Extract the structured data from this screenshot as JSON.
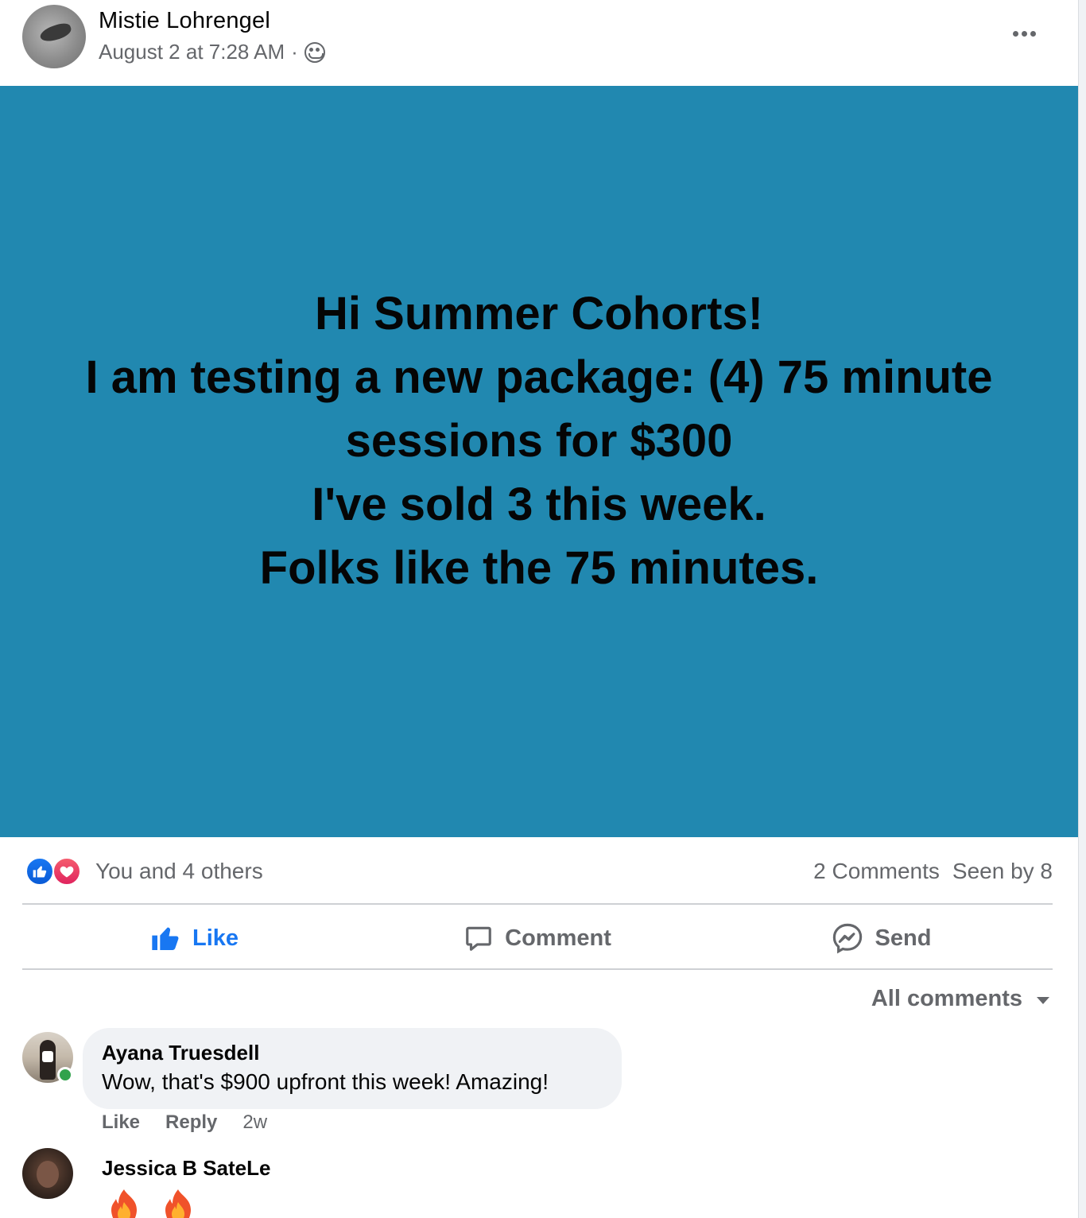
{
  "post": {
    "author": "Mistie Lohrengel",
    "timestamp": "August 2 at 7:28 AM",
    "separator": "·",
    "privacy_icon": "group-icon",
    "more_icon": "more-options-icon",
    "background_color": "#2188b0",
    "text_lines": [
      "Hi Summer Cohorts!",
      "I am testing a new package: (4) 75 minute",
      "sessions for $300",
      "I've sold 3 this week.",
      "Folks like the 75 minutes."
    ]
  },
  "reactions": {
    "icons": [
      "like-reaction-icon",
      "love-reaction-icon"
    ],
    "summary": "You and 4 others",
    "comments_count": "2 Comments",
    "seen_by": "Seen by 8"
  },
  "actions": {
    "like": "Like",
    "comment": "Comment",
    "send": "Send"
  },
  "colors": {
    "accent": "#1877f2",
    "secondary_text": "#65676b",
    "online": "#31a24c"
  },
  "comments": {
    "sort_label": "All comments",
    "items": [
      {
        "author": "Ayana Truesdell",
        "text": "Wow, that's $900 upfront this week! Amazing!",
        "like_label": "Like",
        "reply_label": "Reply",
        "age": "2w"
      },
      {
        "author": "Jessica B SateLe",
        "emoji": "fire-emoji"
      }
    ]
  }
}
